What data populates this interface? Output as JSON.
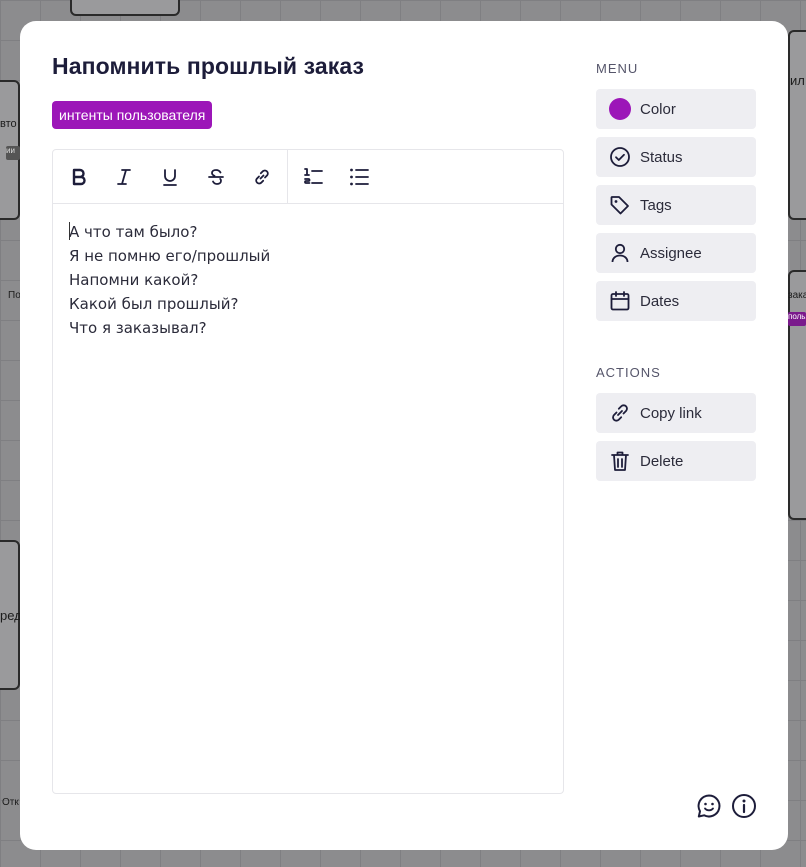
{
  "modal": {
    "title": "Напомнить прошлый заказ",
    "tag": "интенты пользователя",
    "editor": {
      "toolbar": [
        "bold",
        "italic",
        "underline",
        "strikethrough",
        "link",
        "ordered-list",
        "bullet-list"
      ],
      "lines": [
        "А что там было?",
        "Я не помню его/прошлый",
        "Напомни какой?",
        "Какой был прошлый?",
        "Что я заказывал?"
      ]
    },
    "menu": {
      "label": "MENU",
      "items": [
        {
          "label": "Color",
          "icon": "color-swatch-icon"
        },
        {
          "label": "Status",
          "icon": "check-circle-icon"
        },
        {
          "label": "Tags",
          "icon": "tag-icon"
        },
        {
          "label": "Assignee",
          "icon": "user-icon"
        },
        {
          "label": "Dates",
          "icon": "calendar-icon"
        }
      ]
    },
    "actions": {
      "label": "ACTIONS",
      "items": [
        {
          "label": "Copy link",
          "icon": "link-icon"
        },
        {
          "label": "Delete",
          "icon": "trash-icon"
        }
      ]
    },
    "footer": [
      "comment-icon",
      "info-icon"
    ],
    "colors": {
      "accent": "#9c16b8",
      "text": "#1d1d3a",
      "button_bg": "#eeeef2"
    }
  },
  "background": {
    "fragments": [
      "вто",
      "ии",
      "По",
      "заказ",
      "пользо",
      "ил",
      "ред",
      "Отк"
    ]
  }
}
